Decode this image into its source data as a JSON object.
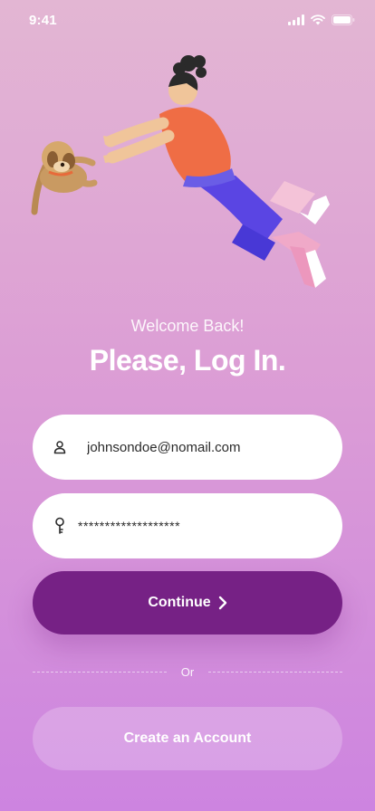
{
  "status_bar": {
    "time": "9:41"
  },
  "welcome": {
    "subtitle": "Welcome Back!",
    "title": "Please, Log In."
  },
  "form": {
    "email_value": "johnsondoe@nomail.com",
    "password_value": "*******************",
    "continue_label": "Continue",
    "divider_label": "Or",
    "create_label": "Create an Account"
  },
  "colors": {
    "primary": "#762185",
    "background_top": "#e3b6d3",
    "background_bottom": "#cd84e0"
  },
  "icons": {
    "email": "user-icon",
    "password": "key-icon",
    "continue": "chevron-right-icon"
  }
}
